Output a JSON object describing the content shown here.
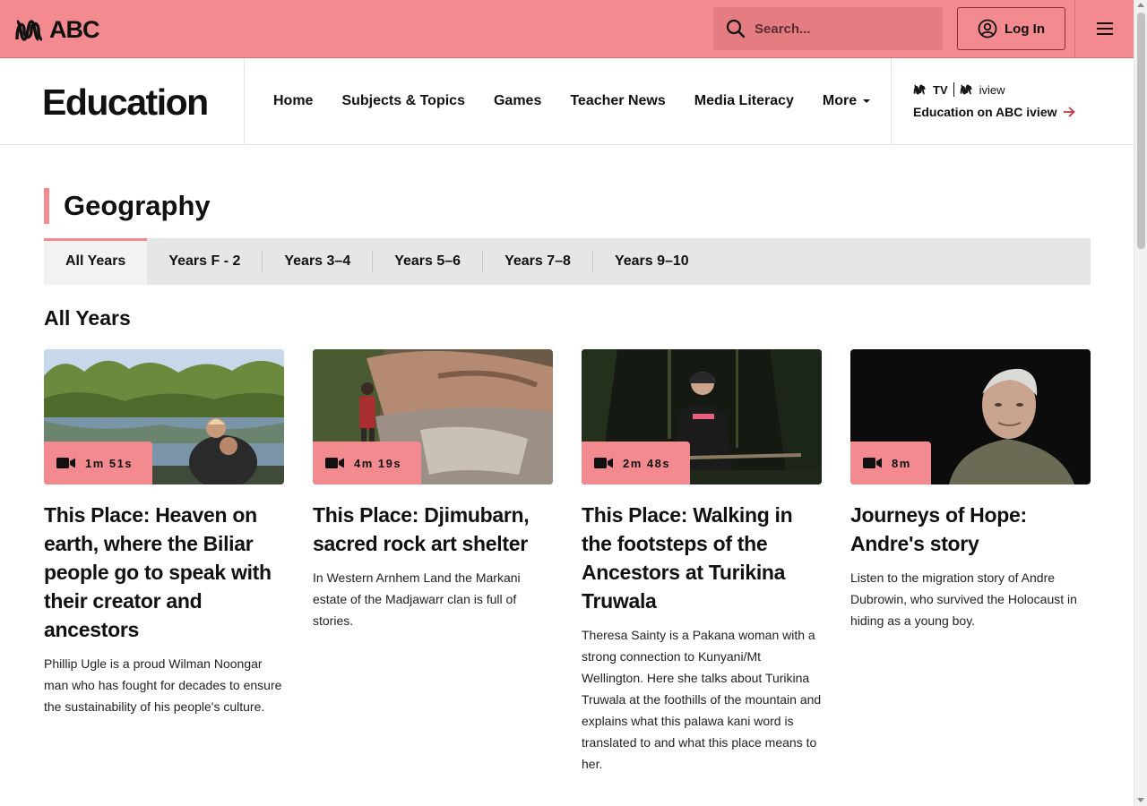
{
  "header": {
    "logo_text": "ABC",
    "search_placeholder": "Search...",
    "login_label": "Log In"
  },
  "edu": {
    "title": "Education",
    "nav": [
      "Home",
      "Subjects & Topics",
      "Games",
      "Teacher News",
      "Media Literacy",
      "More"
    ],
    "brand_tv": "TV",
    "brand_iview": "iview",
    "iview_link": "Education on ABC iview"
  },
  "section": {
    "title": "Geography",
    "tabs": [
      "All Years",
      "Years F - 2",
      "Years 3–4",
      "Years 5–6",
      "Years 7–8",
      "Years 9–10"
    ],
    "active_tab": "All Years",
    "subheading": "All Years"
  },
  "cards": [
    {
      "duration": "1m 51s",
      "title": "This Place: Heaven on earth, where the Biliar people go to speak with their creator and ancestors",
      "desc": "Phillip Ugle is a proud Wilman Noongar man who has fought for decades to ensure the sustainability of his people's culture."
    },
    {
      "duration": "4m 19s",
      "title": "This Place: Djimubarn, sacred rock art shelter",
      "desc": "In Western Arnhem Land the Markani estate of the Madjawarr clan is full of stories."
    },
    {
      "duration": "2m 48s",
      "title": "This Place: Walking in the footsteps of the Ancestors at Turikina Truwala",
      "desc": "Theresa Sainty is a Pakana woman with a strong connection to Kunyani/Mt Wellington. Here she talks about Turikina Truwala at the foothills of the mountain and explains what this palawa kani word is translated to and what this place means to her."
    },
    {
      "duration": "8m",
      "title": "Journeys of Hope: Andre's story",
      "desc": "Listen to the migration story of Andre Dubrowin, who survived the Holocaust in hiding as a young boy."
    }
  ],
  "colors": {
    "accent": "#f28a8f",
    "tabs_bg": "#e6e6e6"
  }
}
